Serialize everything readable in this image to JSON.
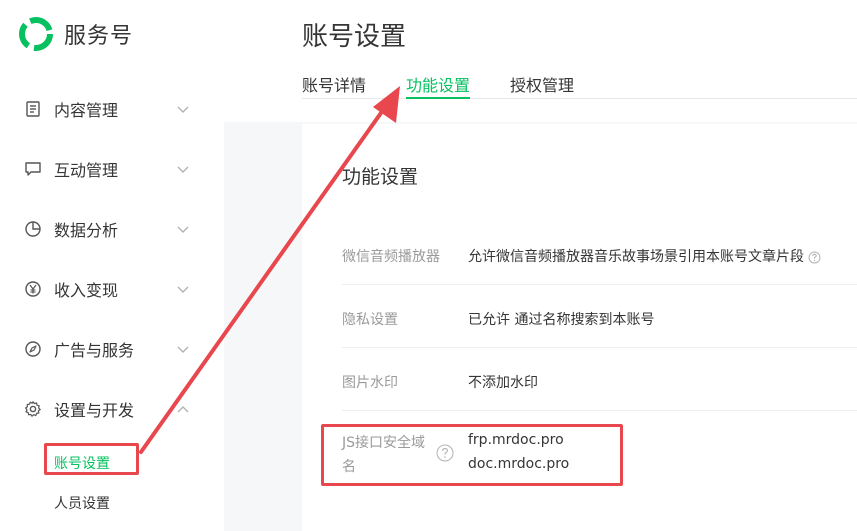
{
  "brand": {
    "name": "服务号"
  },
  "sidebar": {
    "items": [
      {
        "label": "内容管理",
        "icon": "document-icon"
      },
      {
        "label": "互动管理",
        "icon": "chat-icon"
      },
      {
        "label": "数据分析",
        "icon": "pie-chart-icon"
      },
      {
        "label": "收入变现",
        "icon": "yen-icon"
      },
      {
        "label": "广告与服务",
        "icon": "compass-icon"
      },
      {
        "label": "设置与开发",
        "icon": "gear-icon"
      }
    ],
    "sub_items": [
      {
        "label": "账号设置",
        "active": true
      },
      {
        "label": "人员设置",
        "active": false
      }
    ]
  },
  "page": {
    "title": "账号设置",
    "tabs": [
      {
        "label": "账号详情",
        "active": false
      },
      {
        "label": "功能设置",
        "active": true
      },
      {
        "label": "授权管理",
        "active": false
      }
    ]
  },
  "panel": {
    "title": "功能设置",
    "rows": [
      {
        "label": "微信音频播放器",
        "value": "允许微信音频播放器音乐故事场景引用本账号文章片段"
      },
      {
        "label": "隐私设置",
        "value": "已允许 通过名称搜索到本账号"
      },
      {
        "label": "图片水印",
        "value": "不添加水印"
      },
      {
        "label_line1": "JS接口安全域",
        "label_line2": "名",
        "value_line1": "frp.mrdoc.pro",
        "value_line2": "doc.mrdoc.pro"
      }
    ]
  },
  "colors": {
    "accent": "#07c160",
    "annotation": "#e8474d",
    "text": "#353535",
    "muted": "#9a9a9a"
  }
}
